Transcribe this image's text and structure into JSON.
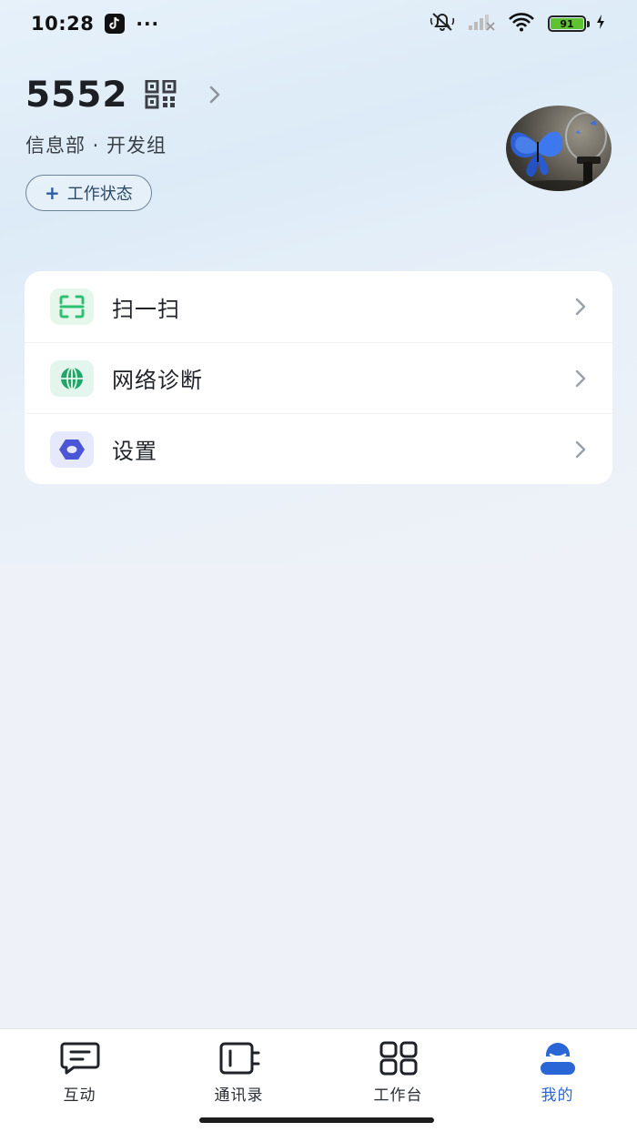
{
  "status_bar": {
    "time": "10:28",
    "more": "···",
    "battery_level": "91",
    "icons": [
      "tiktok-icon",
      "bell-off-icon",
      "signal-icon",
      "wifi-icon",
      "battery-icon",
      "charging-icon"
    ]
  },
  "profile": {
    "name": "5552",
    "department": "信息部 · 开发组",
    "status_button": {
      "plus": "+",
      "label": "工作状态"
    }
  },
  "menu": {
    "items": [
      {
        "label": "扫一扫",
        "icon": "scan-icon"
      },
      {
        "label": "网络诊断",
        "icon": "globe-icon"
      },
      {
        "label": "设置",
        "icon": "settings-icon"
      }
    ]
  },
  "tabbar": {
    "tabs": [
      {
        "label": "互动",
        "icon": "chat-icon",
        "active": false
      },
      {
        "label": "通讯录",
        "icon": "contacts-icon",
        "active": false
      },
      {
        "label": "工作台",
        "icon": "apps-grid-icon",
        "active": false
      },
      {
        "label": "我的",
        "icon": "profile-icon",
        "active": true
      }
    ]
  },
  "colors": {
    "accent": "#2a66d6",
    "scan_green": "#2fbf71",
    "globe_green": "#22a568",
    "settings_purple": "#4b55d6"
  }
}
